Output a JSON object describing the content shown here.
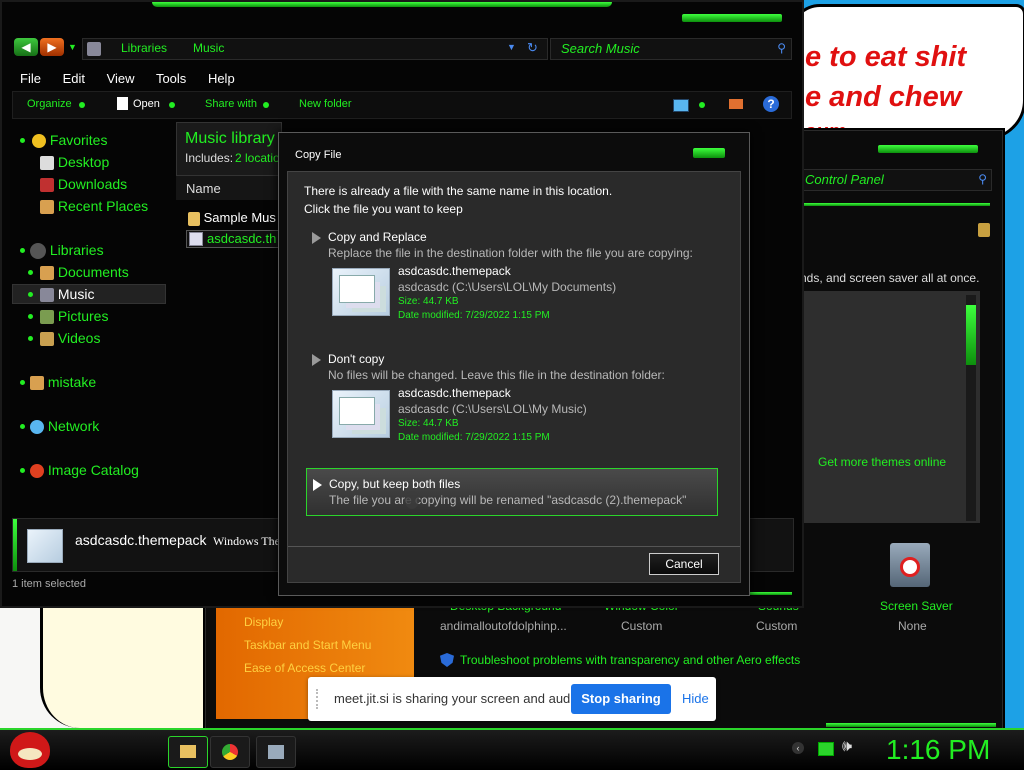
{
  "bubble": {
    "line1": "e to eat shit",
    "line2": "e and chew",
    "line3": "sum"
  },
  "explorer": {
    "breadcrumb": [
      "Libraries",
      "Music"
    ],
    "search_placeholder": "Search Music",
    "menu": [
      "File",
      "Edit",
      "View",
      "Tools",
      "Help"
    ],
    "toolbar": {
      "organize": "Organize",
      "open": "Open",
      "share_with": "Share with",
      "new_folder": "New folder"
    },
    "sidebar": {
      "favorites": "Favorites",
      "desktop": "Desktop",
      "downloads": "Downloads",
      "recent": "Recent Places",
      "libraries": "Libraries",
      "documents": "Documents",
      "music": "Music",
      "pictures": "Pictures",
      "videos": "Videos",
      "mistake": "mistake",
      "network": "Network",
      "image_catalog": "Image Catalog"
    },
    "library_title": "Music library",
    "includes_label": "Includes:",
    "includes_link": "2 locatio",
    "column_name": "Name",
    "files": [
      "Sample Mus",
      "asdcasdc.th"
    ],
    "details_name": "asdcasdc.themepack",
    "details_type": "Windows The",
    "status": "1 item selected"
  },
  "dialog": {
    "title": "Copy File",
    "heading1": "There is already a file with the same name in this location.",
    "heading2": "Click the file you want to keep",
    "opt1_title": "Copy and Replace",
    "opt1_sub": "Replace the file in the destination folder with the file you are copying:",
    "file1_name": "asdcasdc.themepack",
    "file1_path": "asdcasdc (C:\\Users\\LOL\\My Documents)",
    "file1_size": "Size: 44.7 KB",
    "file1_date": "Date modified: 7/29/2022 1:15 PM",
    "opt2_title": "Don't copy",
    "opt2_sub": "No files will be changed. Leave this file in the destination folder:",
    "file2_name": "asdcasdc.themepack",
    "file2_path": "asdcasdc (C:\\Users\\LOL\\My Music)",
    "file2_size": "Size: 44.7 KB",
    "file2_date": "Date modified: 7/29/2022 1:15 PM",
    "opt3_title": "Copy, but keep both files",
    "opt3_sub": "The file you are copying will be renamed \"asdcasdc (2).themepack\"",
    "cancel": "Cancel"
  },
  "control_panel": {
    "search_placeholder": "Control Panel",
    "desc_fragment": "nds, and screen saver all at once.",
    "get_more": "Get more themes online",
    "links": [
      "Display",
      "Taskbar and Start Menu",
      "Ease of Access Center"
    ],
    "items": [
      {
        "label": "Desktop Background",
        "value": "andimalloutofdolphinp..."
      },
      {
        "label": "Window Color",
        "value": "Custom"
      },
      {
        "label": "Sounds",
        "value": "Custom"
      },
      {
        "label": "Screen Saver",
        "value": "None"
      }
    ],
    "troubleshoot": "Troubleshoot problems with transparency and other Aero effects"
  },
  "share_bar": {
    "message": "meet.jit.si is sharing your screen and audio.",
    "stop": "Stop sharing",
    "hide": "Hide"
  },
  "taskbar": {
    "clock": "1:16 PM"
  },
  "colors": {
    "accent_green": "#22ee22",
    "share_blue": "#1a73e8",
    "background_blue": "#1da1e6"
  }
}
